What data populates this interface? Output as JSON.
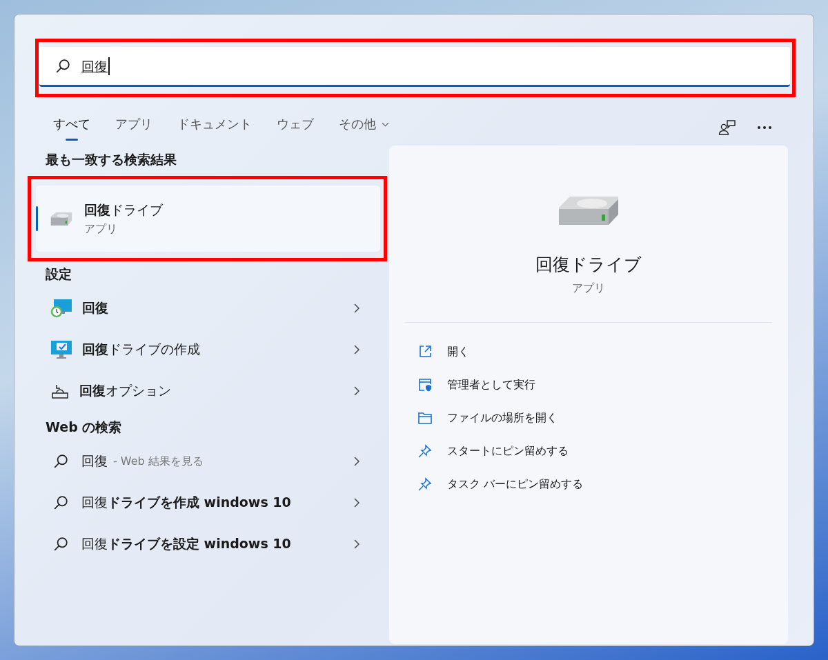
{
  "search": {
    "value": "回復"
  },
  "tabs": [
    {
      "label": "すべて",
      "selected": true
    },
    {
      "label": "アプリ",
      "selected": false
    },
    {
      "label": "ドキュメント",
      "selected": false
    },
    {
      "label": "ウェブ",
      "selected": false
    },
    {
      "label": "その他",
      "selected": false,
      "dropdown": true
    }
  ],
  "best_match": {
    "heading": "最も一致する検索結果",
    "title": "**回復**ドライブ",
    "subtitle": "アプリ",
    "selected": true
  },
  "settings": {
    "heading": "設定",
    "items": [
      {
        "kind": "recovery",
        "label": "**回復**"
      },
      {
        "kind": "create-drive",
        "label": "**回復**ドライブの作成"
      },
      {
        "kind": "options",
        "label": "**回復**オプション"
      }
    ]
  },
  "web_search": {
    "heading": "Web の検索",
    "items": [
      {
        "label": "回復",
        "suffix": "- Web 結果を見る"
      },
      {
        "label": "回復**ドライブを作成 windows 10**"
      },
      {
        "label": "回復**ドライブを設定 windows 10**"
      }
    ]
  },
  "preview": {
    "title": "回復ドライブ",
    "subtitle": "アプリ",
    "actions": [
      {
        "kind": "open",
        "label": "開く"
      },
      {
        "kind": "admin",
        "label": "管理者として実行"
      },
      {
        "kind": "folder",
        "label": "ファイルの場所を開く"
      },
      {
        "kind": "pin",
        "label": "スタートにピン留めする"
      },
      {
        "kind": "pin",
        "label": "タスク バーにピン留めする"
      }
    ]
  }
}
